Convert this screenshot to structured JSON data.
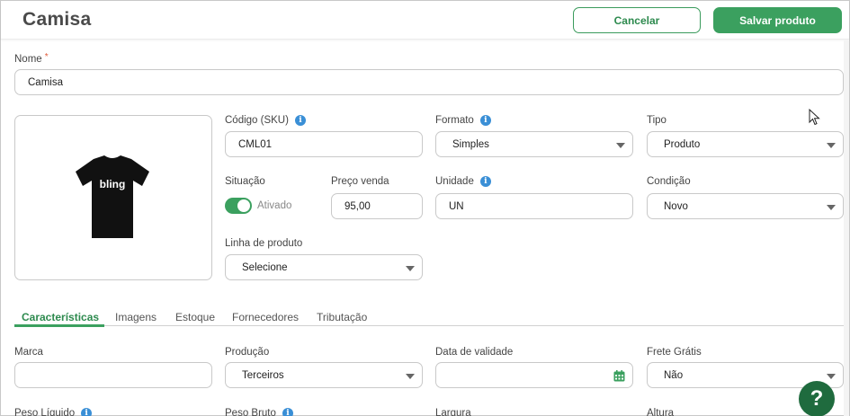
{
  "header": {
    "title": "Camisa",
    "cancel_label": "Cancelar",
    "save_label": "Salvar produto"
  },
  "form": {
    "nome": {
      "label": "Nome",
      "required_mark": "*",
      "value": "Camisa"
    },
    "image": {
      "logo_text": "bling",
      "description_icon": "tshirt-image"
    },
    "sku": {
      "label": "Código (SKU)",
      "value": "CML01"
    },
    "formato": {
      "label": "Formato",
      "value": "Simples"
    },
    "tipo": {
      "label": "Tipo",
      "value": "Produto"
    },
    "situacao": {
      "label": "Situação",
      "state_text": "Ativado",
      "on": true
    },
    "preco": {
      "label": "Preço venda",
      "value": "95,00"
    },
    "unidade": {
      "label": "Unidade",
      "value": "UN"
    },
    "condicao": {
      "label": "Condição",
      "value": "Novo"
    },
    "linha": {
      "label": "Linha de produto",
      "value": "Selecione"
    }
  },
  "tabs": [
    {
      "label": "Características",
      "active": true
    },
    {
      "label": "Imagens"
    },
    {
      "label": "Estoque"
    },
    {
      "label": "Fornecedores"
    },
    {
      "label": "Tributação"
    }
  ],
  "caracteristicas": {
    "marca": {
      "label": "Marca",
      "value": ""
    },
    "producao": {
      "label": "Produção",
      "value": "Terceiros"
    },
    "validade": {
      "label": "Data de validade",
      "value": ""
    },
    "frete": {
      "label": "Frete Grátis",
      "value": "Não"
    },
    "peso_liquido": {
      "label": "Peso Líquido"
    },
    "peso_bruto": {
      "label": "Peso Bruto"
    },
    "largura": {
      "label": "Largura"
    },
    "altura": {
      "label": "Altura"
    }
  },
  "help": {
    "label": "?"
  },
  "colors": {
    "accent": "#3ba05f",
    "info": "#3a8fd6",
    "help_bg": "#1f6b3e"
  }
}
